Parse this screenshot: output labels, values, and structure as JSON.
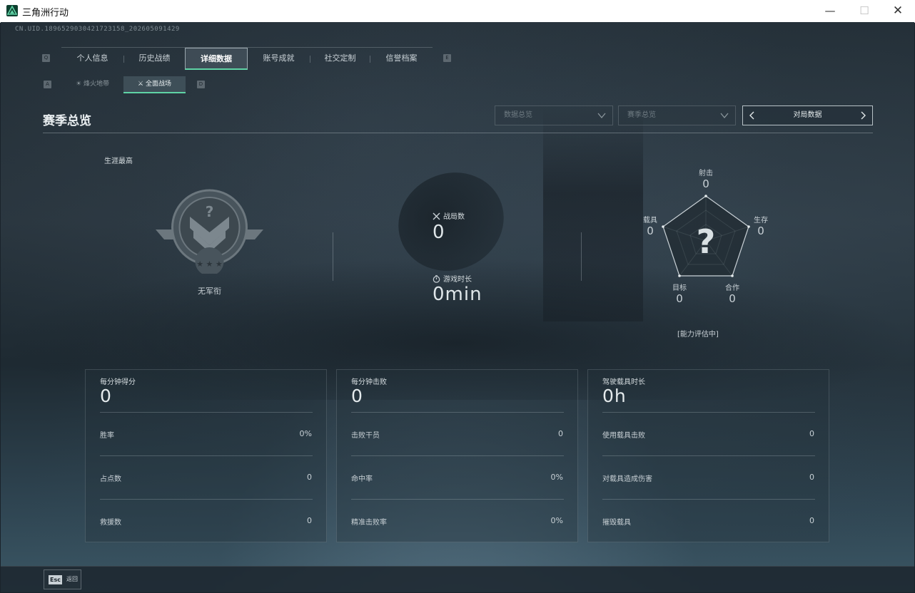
{
  "window": {
    "title": "三角洲行动",
    "minimize": "—",
    "maximize": "☐",
    "close": "✕"
  },
  "uid": "CN.UID.1896529030421723158_202605091429",
  "keyhints": {
    "tab_left": "Q",
    "tab_right": "E",
    "sub_left": "A",
    "sub_right": "D"
  },
  "tabs": [
    {
      "label": "个人信息",
      "active": false
    },
    {
      "label": "历史战绩",
      "active": false
    },
    {
      "label": "详细数据",
      "active": true
    },
    {
      "label": "账号成就",
      "active": false
    },
    {
      "label": "社交定制",
      "active": false
    },
    {
      "label": "信誉档案",
      "active": false
    }
  ],
  "subtabs": [
    {
      "label": "烽火地带",
      "active": false
    },
    {
      "label": "全面战场",
      "active": true
    }
  ],
  "section": {
    "title": "赛季总览",
    "dropdown_stats": "数据总览",
    "dropdown_season": "赛季总览",
    "pager_label": "对局数据"
  },
  "career": {
    "label": "生涯最高",
    "rank_name": "无军衔"
  },
  "summary": {
    "matches_label": "战局数",
    "matches_value": "0",
    "playtime_label": "游戏时长",
    "playtime_value": "0min"
  },
  "radar": {
    "shoot_label": "射击",
    "shoot_value": "0",
    "survive_label": "生存",
    "survive_value": "0",
    "coop_label": "合作",
    "coop_value": "0",
    "target_label": "目标",
    "target_value": "0",
    "vehicle_label": "载具",
    "vehicle_value": "0",
    "status": "[能力评估中]"
  },
  "cards": [
    {
      "head": "每分钟得分",
      "big": "0",
      "rows": [
        {
          "label": "胜率",
          "value": "0%"
        },
        {
          "label": "占点数",
          "value": "0"
        },
        {
          "label": "救援数",
          "value": "0"
        }
      ]
    },
    {
      "head": "每分钟击败",
      "big": "0",
      "rows": [
        {
          "label": "击败干员",
          "value": "0"
        },
        {
          "label": "命中率",
          "value": "0%"
        },
        {
          "label": "精准击败率",
          "value": "0%"
        }
      ]
    },
    {
      "head": "驾驶载具时长",
      "big": "0h",
      "rows": [
        {
          "label": "使用载具击败",
          "value": "0"
        },
        {
          "label": "对载具造成伤害",
          "value": "0"
        },
        {
          "label": "摧毁载具",
          "value": "0"
        }
      ]
    }
  ],
  "bottom": {
    "esc_key": "Esc",
    "esc_label": "返回"
  },
  "colors": {
    "accent": "#5fd3a5",
    "text": "#c9d1d6"
  }
}
